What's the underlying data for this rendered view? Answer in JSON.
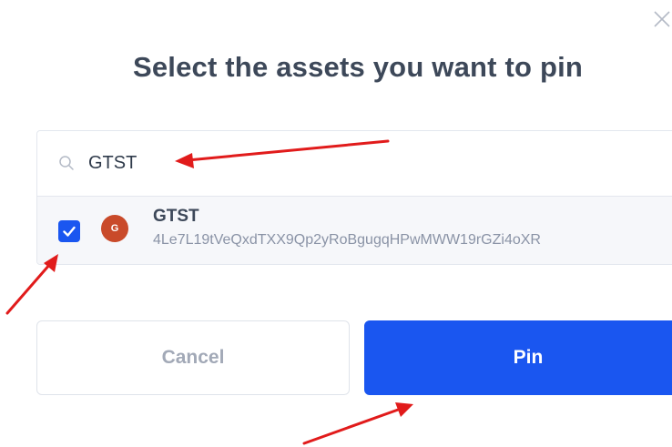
{
  "dialog": {
    "title": "Select the assets you want to pin",
    "close_icon": "close-icon"
  },
  "search": {
    "icon": "search-icon",
    "value": "GTST",
    "placeholder": ""
  },
  "assets": [
    {
      "checked": true,
      "avatar_letter": "G",
      "avatar_color": "#c94a2a",
      "name": "GTST",
      "id": "4Le7L19tVeQxdTXX9Qp2yRoBgugqHPwMWW19rGZi4oXR"
    }
  ],
  "buttons": {
    "cancel_label": "Cancel",
    "pin_label": "Pin"
  },
  "colors": {
    "accent": "#1a56f0",
    "title": "#3d4859",
    "muted": "#8a93a6",
    "annotation_arrow": "#e11b1b"
  },
  "annotations": {
    "icon": "red-arrow"
  }
}
